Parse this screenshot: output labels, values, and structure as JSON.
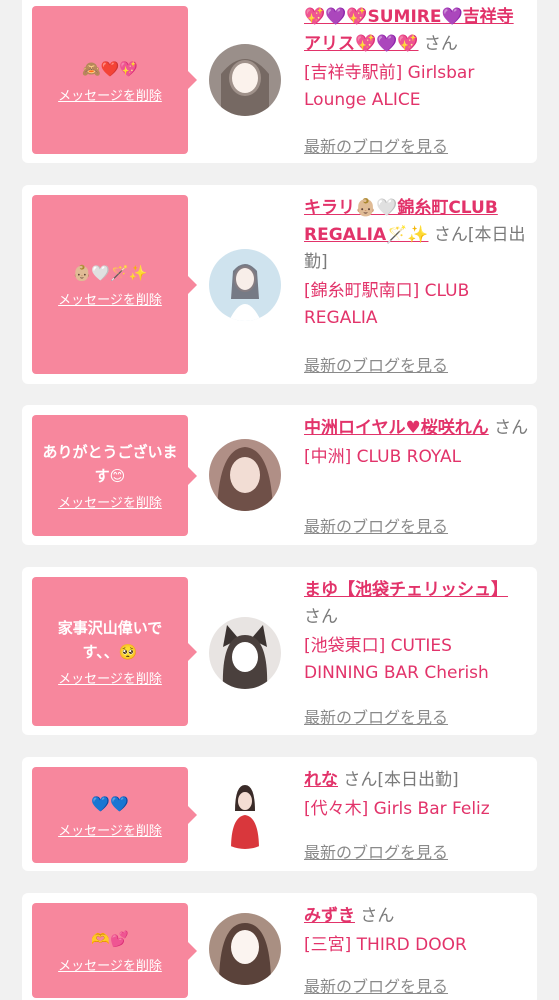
{
  "common": {
    "delete_label": "メッセージを削除",
    "blog_label": "最新のブログを見る"
  },
  "colors": {
    "bubble": "#f7879d",
    "name": "#e2336a",
    "muted": "#7a7a7a",
    "background": "#f1f1f1"
  },
  "items": [
    {
      "message": "🙈❤️💖",
      "name": "💖💜💖SUMIRE💜吉祥寺アリス💖💜💖",
      "suffix": "さん",
      "shop": "[吉祥寺駅前] Girlsbar Lounge ALICE",
      "avatar_color": "#9a8f8a"
    },
    {
      "message": "👶🏼🤍🪄✨",
      "name": "キラリ👶🏼🤍錦糸町CLUB REGALIA🪄✨",
      "suffix": "さん[本日出勤]",
      "shop": "[錦糸町駅南口] CLUB REGALIA",
      "avatar_color": "#cfe3ee"
    },
    {
      "message": "ありがとうございます😊",
      "name": "中洲ロイヤル♥桜咲れん",
      "suffix": "さん",
      "shop": "[中洲] CLUB ROYAL",
      "avatar_color": "#b08f86"
    },
    {
      "message": "家事沢山偉いです、、🥺",
      "name": "まゆ【池袋チェリッシュ】",
      "suffix": "さん",
      "shop": "[池袋東口] CUTIES DINNING BAR Cherish",
      "avatar_color": "#e8e4e2"
    },
    {
      "message": "💙💙",
      "name": "れな",
      "suffix": "さん[本日出勤]",
      "shop": "[代々木] Girls Bar Feliz",
      "avatar_color": "#d9373c"
    },
    {
      "message": "🫶💕",
      "name": "みずき",
      "suffix": "さん",
      "shop": "[三宮] THIRD DOOR",
      "avatar_color": "#a98f82"
    }
  ]
}
